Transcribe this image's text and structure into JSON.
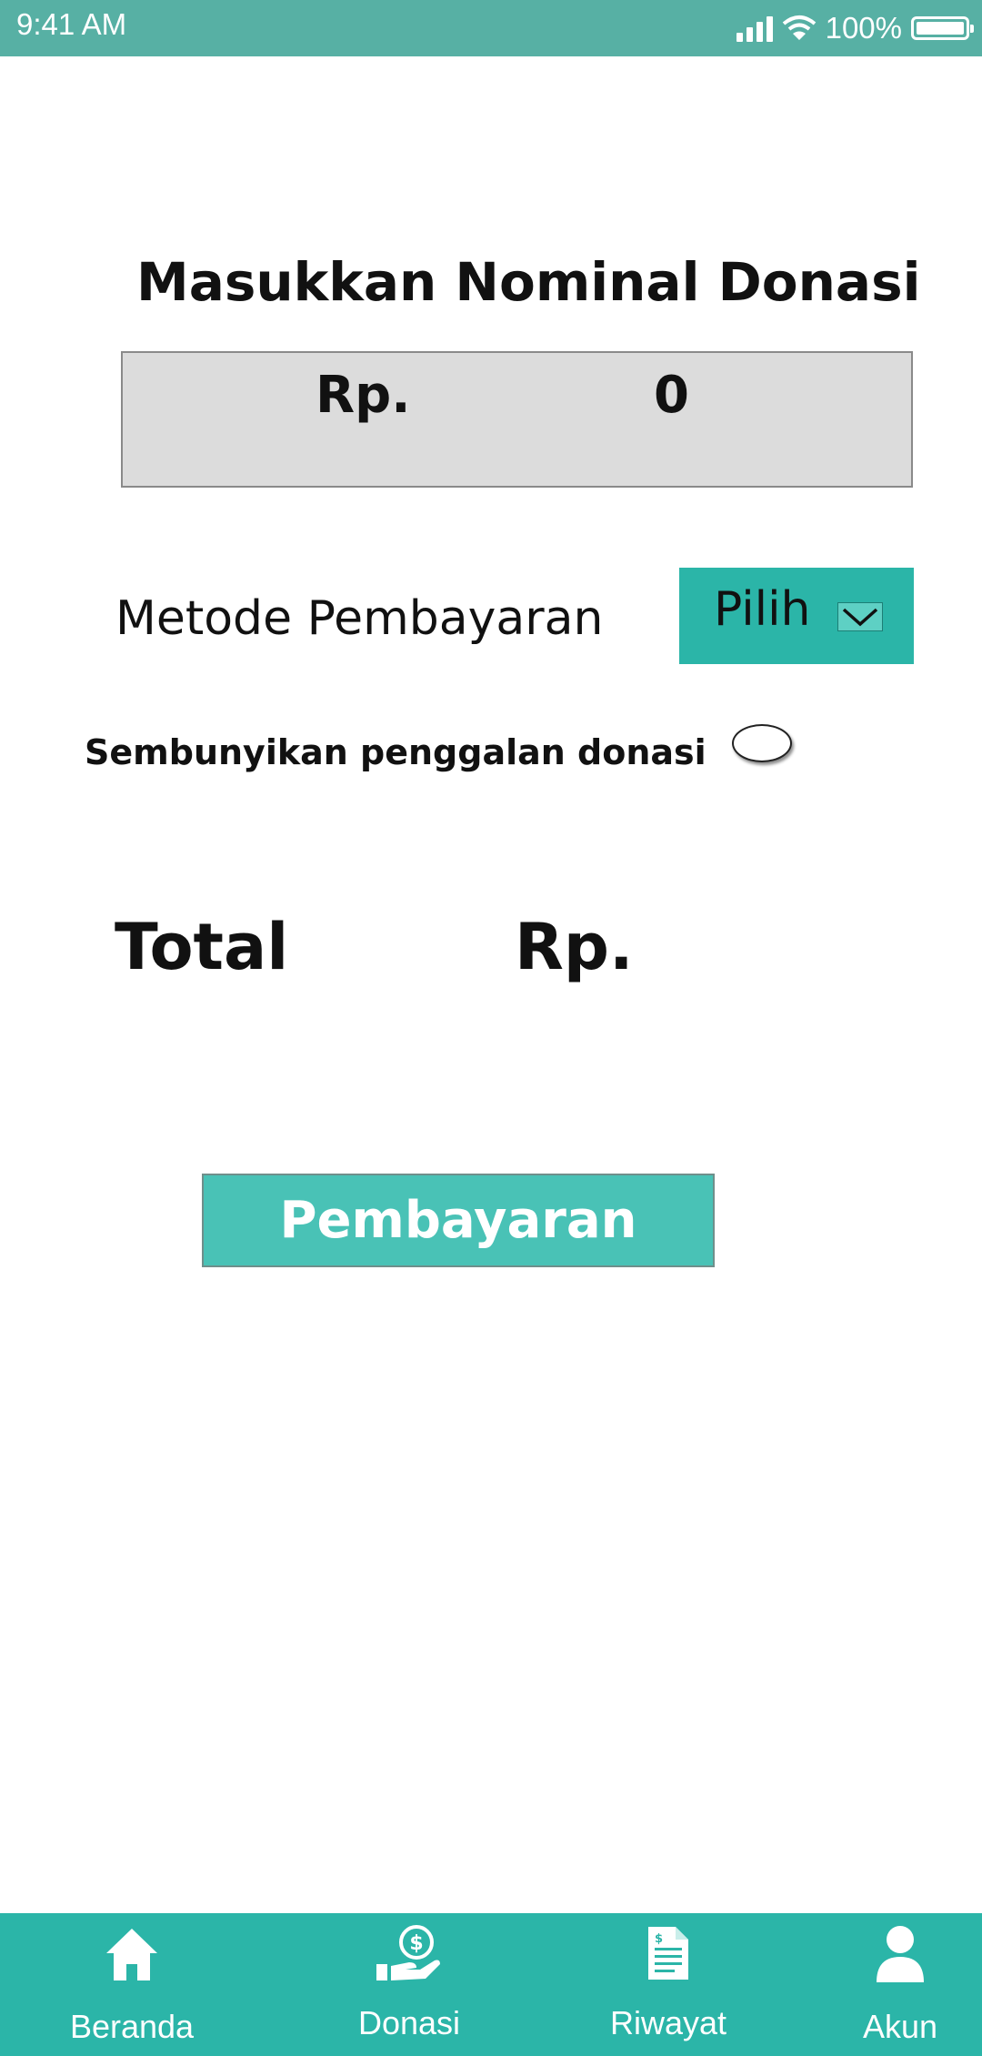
{
  "status_bar": {
    "time": "9:41 AM",
    "battery": "100%"
  },
  "donation": {
    "title": "Masukkan Nominal Donasi",
    "currency_prefix": "Rp.",
    "amount": "0"
  },
  "payment_method": {
    "label": "Metode Pembayaran",
    "dropdown_value": "Pilih"
  },
  "anonymous": {
    "label": "Sembunyikan penggalan donasi",
    "enabled": false
  },
  "total": {
    "label": "Total",
    "currency_prefix": "Rp."
  },
  "pay_button": {
    "label": "Pembayaran"
  },
  "bottom_nav": {
    "items": [
      {
        "label": "Beranda",
        "icon": "home-icon"
      },
      {
        "label": "Donasi",
        "icon": "donation-icon"
      },
      {
        "label": "Riwayat",
        "icon": "document-icon"
      },
      {
        "label": "Akun",
        "icon": "user-icon"
      }
    ]
  },
  "colors": {
    "status_bar": "#57b0a4",
    "accent": "#2bb5a8",
    "button": "#49c2b6",
    "input_bg": "#dcdcdc"
  }
}
